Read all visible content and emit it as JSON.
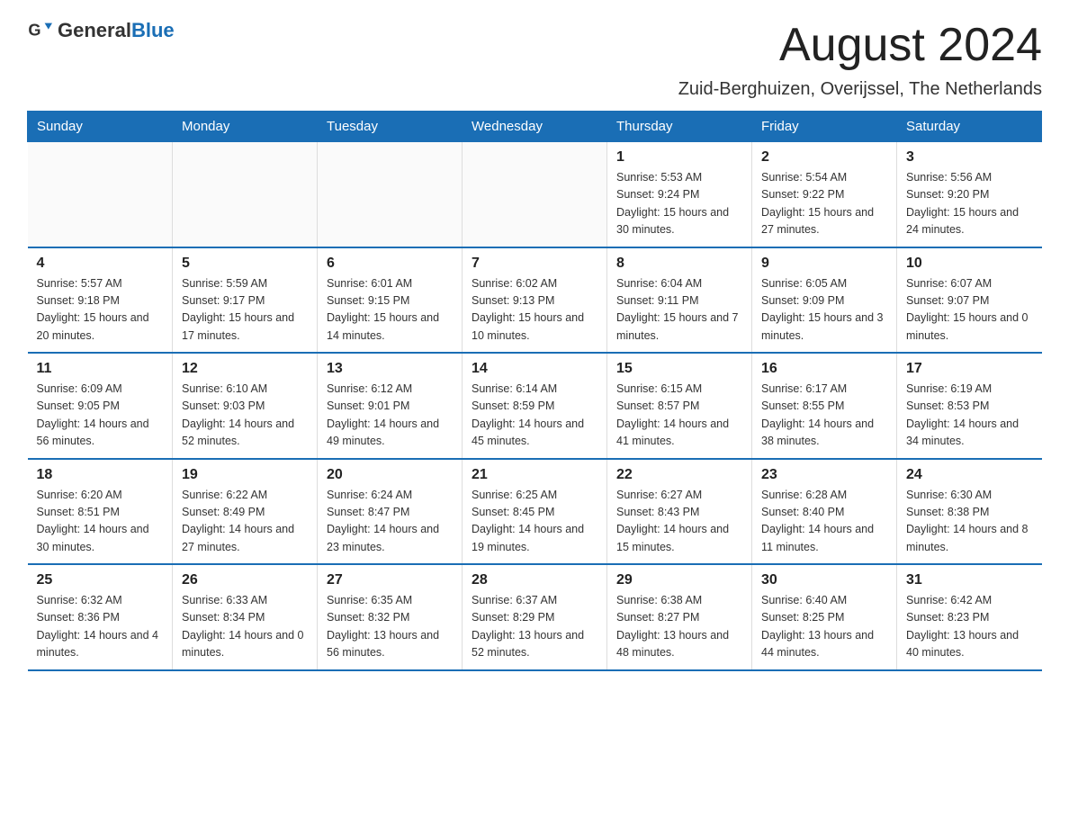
{
  "logo": {
    "text_general": "General",
    "text_blue": "Blue"
  },
  "title": "August 2024",
  "location": "Zuid-Berghuizen, Overijssel, The Netherlands",
  "days_of_week": [
    "Sunday",
    "Monday",
    "Tuesday",
    "Wednesday",
    "Thursday",
    "Friday",
    "Saturday"
  ],
  "weeks": [
    [
      {
        "day": "",
        "info": ""
      },
      {
        "day": "",
        "info": ""
      },
      {
        "day": "",
        "info": ""
      },
      {
        "day": "",
        "info": ""
      },
      {
        "day": "1",
        "info": "Sunrise: 5:53 AM\nSunset: 9:24 PM\nDaylight: 15 hours and 30 minutes."
      },
      {
        "day": "2",
        "info": "Sunrise: 5:54 AM\nSunset: 9:22 PM\nDaylight: 15 hours and 27 minutes."
      },
      {
        "day": "3",
        "info": "Sunrise: 5:56 AM\nSunset: 9:20 PM\nDaylight: 15 hours and 24 minutes."
      }
    ],
    [
      {
        "day": "4",
        "info": "Sunrise: 5:57 AM\nSunset: 9:18 PM\nDaylight: 15 hours and 20 minutes."
      },
      {
        "day": "5",
        "info": "Sunrise: 5:59 AM\nSunset: 9:17 PM\nDaylight: 15 hours and 17 minutes."
      },
      {
        "day": "6",
        "info": "Sunrise: 6:01 AM\nSunset: 9:15 PM\nDaylight: 15 hours and 14 minutes."
      },
      {
        "day": "7",
        "info": "Sunrise: 6:02 AM\nSunset: 9:13 PM\nDaylight: 15 hours and 10 minutes."
      },
      {
        "day": "8",
        "info": "Sunrise: 6:04 AM\nSunset: 9:11 PM\nDaylight: 15 hours and 7 minutes."
      },
      {
        "day": "9",
        "info": "Sunrise: 6:05 AM\nSunset: 9:09 PM\nDaylight: 15 hours and 3 minutes."
      },
      {
        "day": "10",
        "info": "Sunrise: 6:07 AM\nSunset: 9:07 PM\nDaylight: 15 hours and 0 minutes."
      }
    ],
    [
      {
        "day": "11",
        "info": "Sunrise: 6:09 AM\nSunset: 9:05 PM\nDaylight: 14 hours and 56 minutes."
      },
      {
        "day": "12",
        "info": "Sunrise: 6:10 AM\nSunset: 9:03 PM\nDaylight: 14 hours and 52 minutes."
      },
      {
        "day": "13",
        "info": "Sunrise: 6:12 AM\nSunset: 9:01 PM\nDaylight: 14 hours and 49 minutes."
      },
      {
        "day": "14",
        "info": "Sunrise: 6:14 AM\nSunset: 8:59 PM\nDaylight: 14 hours and 45 minutes."
      },
      {
        "day": "15",
        "info": "Sunrise: 6:15 AM\nSunset: 8:57 PM\nDaylight: 14 hours and 41 minutes."
      },
      {
        "day": "16",
        "info": "Sunrise: 6:17 AM\nSunset: 8:55 PM\nDaylight: 14 hours and 38 minutes."
      },
      {
        "day": "17",
        "info": "Sunrise: 6:19 AM\nSunset: 8:53 PM\nDaylight: 14 hours and 34 minutes."
      }
    ],
    [
      {
        "day": "18",
        "info": "Sunrise: 6:20 AM\nSunset: 8:51 PM\nDaylight: 14 hours and 30 minutes."
      },
      {
        "day": "19",
        "info": "Sunrise: 6:22 AM\nSunset: 8:49 PM\nDaylight: 14 hours and 27 minutes."
      },
      {
        "day": "20",
        "info": "Sunrise: 6:24 AM\nSunset: 8:47 PM\nDaylight: 14 hours and 23 minutes."
      },
      {
        "day": "21",
        "info": "Sunrise: 6:25 AM\nSunset: 8:45 PM\nDaylight: 14 hours and 19 minutes."
      },
      {
        "day": "22",
        "info": "Sunrise: 6:27 AM\nSunset: 8:43 PM\nDaylight: 14 hours and 15 minutes."
      },
      {
        "day": "23",
        "info": "Sunrise: 6:28 AM\nSunset: 8:40 PM\nDaylight: 14 hours and 11 minutes."
      },
      {
        "day": "24",
        "info": "Sunrise: 6:30 AM\nSunset: 8:38 PM\nDaylight: 14 hours and 8 minutes."
      }
    ],
    [
      {
        "day": "25",
        "info": "Sunrise: 6:32 AM\nSunset: 8:36 PM\nDaylight: 14 hours and 4 minutes."
      },
      {
        "day": "26",
        "info": "Sunrise: 6:33 AM\nSunset: 8:34 PM\nDaylight: 14 hours and 0 minutes."
      },
      {
        "day": "27",
        "info": "Sunrise: 6:35 AM\nSunset: 8:32 PM\nDaylight: 13 hours and 56 minutes."
      },
      {
        "day": "28",
        "info": "Sunrise: 6:37 AM\nSunset: 8:29 PM\nDaylight: 13 hours and 52 minutes."
      },
      {
        "day": "29",
        "info": "Sunrise: 6:38 AM\nSunset: 8:27 PM\nDaylight: 13 hours and 48 minutes."
      },
      {
        "day": "30",
        "info": "Sunrise: 6:40 AM\nSunset: 8:25 PM\nDaylight: 13 hours and 44 minutes."
      },
      {
        "day": "31",
        "info": "Sunrise: 6:42 AM\nSunset: 8:23 PM\nDaylight: 13 hours and 40 minutes."
      }
    ]
  ]
}
